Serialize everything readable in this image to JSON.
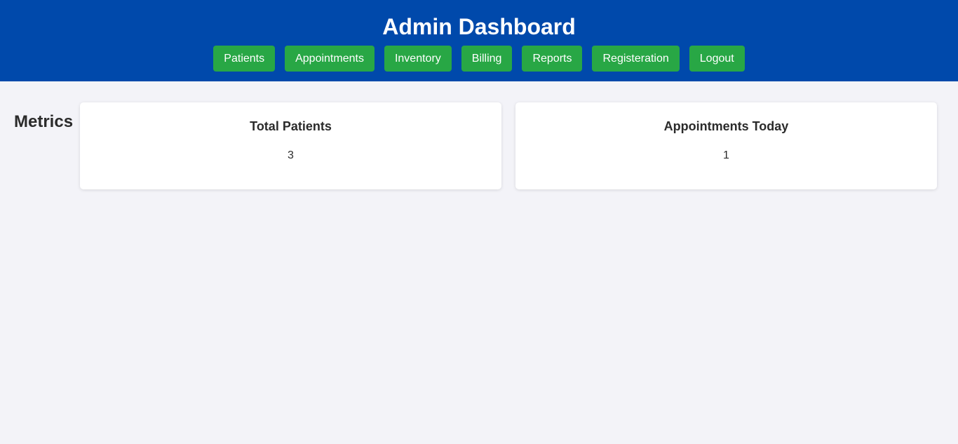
{
  "header": {
    "title": "Admin Dashboard",
    "nav": [
      {
        "label": "Patients"
      },
      {
        "label": "Appointments"
      },
      {
        "label": "Inventory"
      },
      {
        "label": "Billing"
      },
      {
        "label": "Reports"
      },
      {
        "label": "Registeration"
      },
      {
        "label": "Logout"
      }
    ]
  },
  "metrics": {
    "heading": "Metrics",
    "cards": [
      {
        "title": "Total Patients",
        "value": "3"
      },
      {
        "title": "Appointments Today",
        "value": "1"
      }
    ]
  },
  "colors": {
    "header_bg": "#0049ab",
    "nav_button_bg": "#28a745",
    "page_bg": "#f3f3f8",
    "card_bg": "#ffffff"
  }
}
